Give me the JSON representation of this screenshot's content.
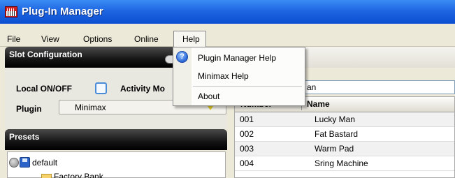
{
  "window": {
    "title": "Plug-In Manager"
  },
  "menubar": {
    "items": [
      "File",
      "View",
      "Options",
      "Online",
      "Help"
    ]
  },
  "help_menu": {
    "items": [
      "Plugin Manager Help",
      "Minimax Help",
      "About"
    ]
  },
  "slot_config": {
    "title": "Slot Configuration",
    "local_label": "Local ON/OFF",
    "activity_label": "Activity Mo",
    "plugin_label": "Plugin",
    "plugin_value": "Minimax"
  },
  "presets": {
    "title": "Presets",
    "tree": [
      {
        "label": "default"
      },
      {
        "label": "Factory Bank"
      }
    ]
  },
  "search": {
    "value": "an"
  },
  "table": {
    "columns": [
      "Number",
      "Name"
    ],
    "rows": [
      {
        "number": "001",
        "name": "Lucky Man"
      },
      {
        "number": "002",
        "name": "Fat Bastard"
      },
      {
        "number": "003",
        "name": "Warm Pad"
      },
      {
        "number": "004",
        "name": "Sring Machine"
      }
    ]
  },
  "colors": {
    "titlebar": "#1e66e2",
    "panel_header": "#141414",
    "checkbox_border": "#4b8cd8",
    "dropdown_arrow": "#e6d02a"
  },
  "icons": [
    "app-keyboard-icon",
    "help-icon",
    "save-icon",
    "folder-icon",
    "dropdown-arrow-icon"
  ]
}
